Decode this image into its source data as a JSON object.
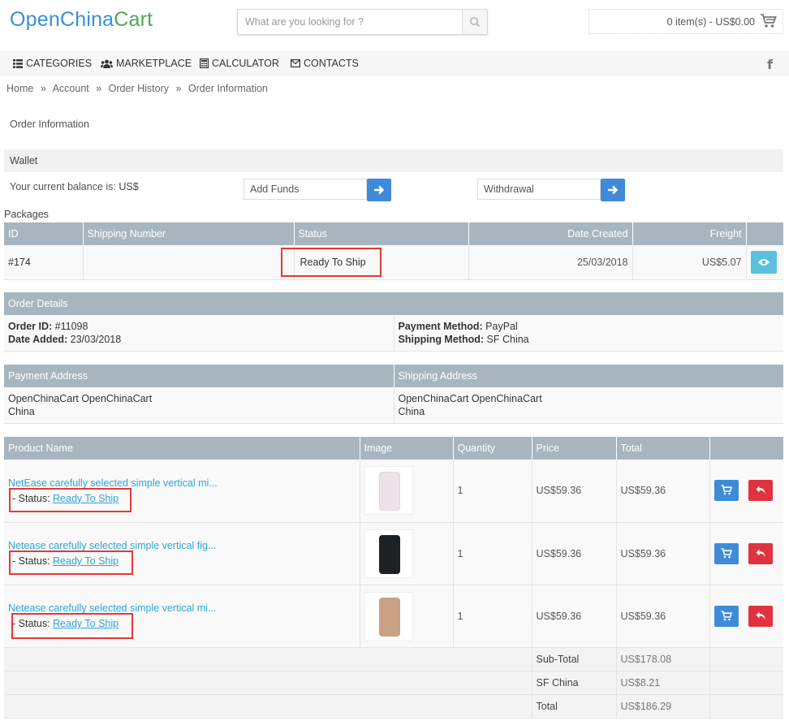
{
  "header": {
    "logo_part1": "Open",
    "logo_part2": "China",
    "logo_part3": "Cart",
    "search_placeholder": "What are you looking for ?",
    "cart_summary": "0 item(s) - US$0.00"
  },
  "nav": {
    "categories": "CATEGORIES",
    "marketplace": "MARKETPLACE",
    "calculator": "CALCULATOR",
    "contacts": "CONTACTS",
    "social": "f"
  },
  "breadcrumb": {
    "items": [
      "Home",
      "Account",
      "Order History",
      "Order Information"
    ],
    "separator": "»"
  },
  "page_title": "Order Information",
  "wallet": {
    "heading": "Wallet",
    "balance_label": "Your current balance is:",
    "balance_value": "US$",
    "add_funds_placeholder": "Add Funds",
    "withdrawal_placeholder": "Withdrawal"
  },
  "packages": {
    "label": "Packages",
    "headers": [
      "ID",
      "Shipping Number",
      "Status",
      "Date Created",
      "Freight"
    ],
    "row": {
      "id": "#174",
      "shipping_number": "",
      "status": "Ready To Ship",
      "date_created": "25/03/2018",
      "freight": "US$5.07"
    }
  },
  "order_details": {
    "heading": "Order Details",
    "order_id_label": "Order ID:",
    "order_id": "#11098",
    "date_added_label": "Date Added:",
    "date_added": "23/03/2018",
    "payment_method_label": "Payment Method:",
    "payment_method": "PayPal",
    "shipping_method_label": "Shipping Method:",
    "shipping_method": "SF China"
  },
  "addresses": {
    "payment_heading": "Payment Address",
    "shipping_heading": "Shipping Address",
    "payment_line1": "OpenChinaCart OpenChinaCart",
    "payment_line2": "China",
    "shipping_line1": "OpenChinaCart OpenChinaCart",
    "shipping_line2": "China"
  },
  "products": {
    "headers": [
      "Product Name",
      "Image",
      "Quantity",
      "Price",
      "Total"
    ],
    "status_label": "- Status:",
    "items": [
      {
        "name": "NetEase carefully selected simple vertical mi...",
        "status": "Ready To Ship",
        "quantity": "1",
        "price": "US$59.36",
        "total": "US$59.36",
        "color": "#ece3e8"
      },
      {
        "name": "Netease carefully selected simple vertical fig...",
        "status": "Ready To Ship",
        "quantity": "1",
        "price": "US$59.36",
        "total": "US$59.36",
        "color": "#1e2224"
      },
      {
        "name": "Netease carefully selected simple vertical mi...",
        "status": "Ready To Ship",
        "quantity": "1",
        "price": "US$59.36",
        "total": "US$59.36",
        "color": "#c9a185"
      }
    ],
    "totals": [
      {
        "label": "Sub-Total",
        "value": "US$178.08"
      },
      {
        "label": "SF China",
        "value": "US$8.21"
      },
      {
        "label": "Total",
        "value": "US$186.29"
      }
    ]
  }
}
